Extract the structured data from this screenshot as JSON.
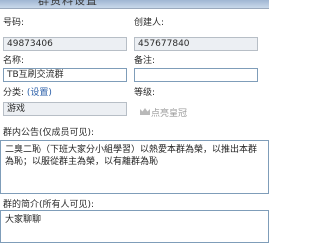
{
  "window": {
    "title": "群资料设置"
  },
  "group": {
    "number_label": "号码:",
    "number_value": "49873406",
    "creator_label": "创建人:",
    "creator_value": "457677840",
    "name_label": "名称:",
    "name_value": "TB互刷交流群",
    "remark_label": "备注:",
    "remark_value": "",
    "category_label": "分类:",
    "category_link": "(设置)",
    "category_value": "游戏",
    "level_label": "等级:",
    "level_text": "点亮皇冠",
    "level_icon": "crown-icon"
  },
  "announcement": {
    "label": "群内公告(仅成员可见):",
    "text": "二臭二恥（下班大家分小組學習）以熱愛本群為榮，以推出本群為恥；以服從群主為榮，以有離群為恥"
  },
  "intro": {
    "label": "群的简介(所有人可见):",
    "text": "大家聊聊"
  },
  "colors": {
    "readonly_bg": "#eceff3",
    "input_border": "#7f9db9",
    "link": "#2b5fa8"
  }
}
